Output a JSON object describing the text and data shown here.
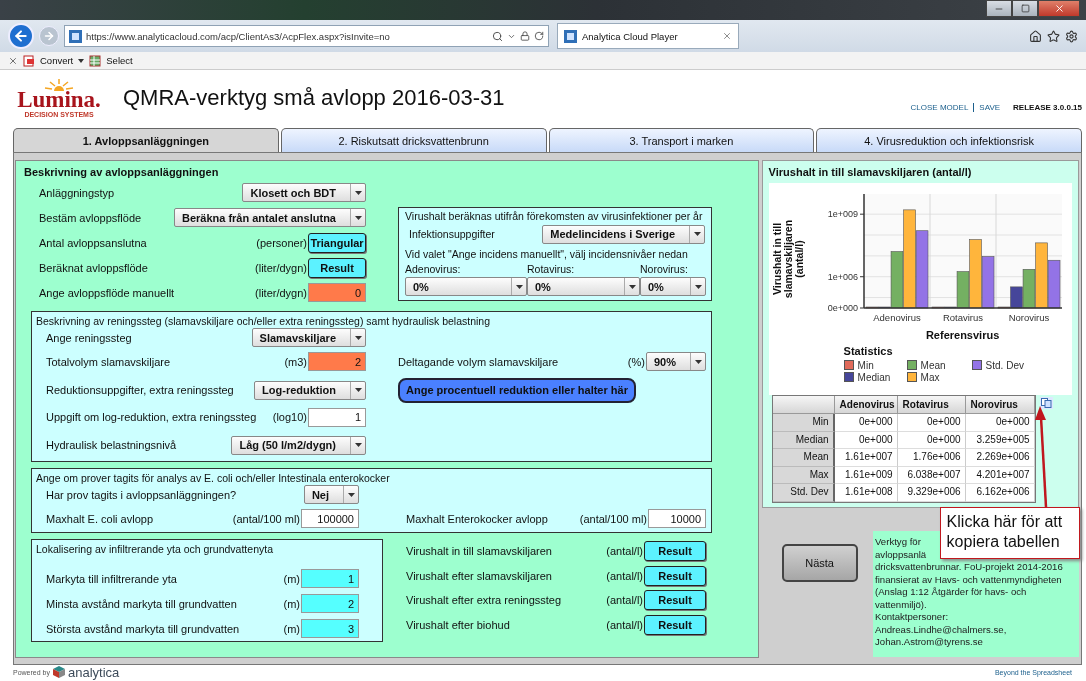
{
  "browser": {
    "url": "https://www.analyticacloud.com/acp/ClientAs3/AcpFlex.aspx?isInvite=no",
    "tab_title": "Analytica Cloud Player",
    "commands": [
      "Convert",
      "Select"
    ]
  },
  "header": {
    "logo": "Lumina.",
    "logo_sub": "DECISION SYSTEMS",
    "title": "QMRA-verktyg små avlopp 2016-03-31",
    "links": [
      "CLOSE MODEL",
      "SAVE"
    ],
    "release": "RELEASE 3.0.0.15"
  },
  "tabs": [
    {
      "label": "1. Avloppsanläggningen",
      "selected": true
    },
    {
      "label": "2. Riskutsatt dricksvattenbrunn",
      "selected": false
    },
    {
      "label": "3. Transport i marken",
      "selected": false
    },
    {
      "label": "4. Virusreduktion och infektionsrisk",
      "selected": false
    }
  ],
  "facility": {
    "title": "Beskrivning av avloppsanläggningen",
    "rows": [
      {
        "kind": "dropdown",
        "label": "Anläggningstyp",
        "value": "Klosett och BDT"
      },
      {
        "kind": "dropdown",
        "label": "Bestäm avloppsflöde",
        "value": "Beräkna från antalet anslutna"
      },
      {
        "kind": "button",
        "label": "Antal avloppsanslutna",
        "unit": "(personer)",
        "value": "Triangular"
      },
      {
        "kind": "button",
        "label": "Beräknat avloppsflöde",
        "unit": "(liter/dygn)",
        "value": "Result"
      },
      {
        "kind": "edit",
        "label": "Ange avloppsflöde manuellt",
        "unit": "(liter/dygn)",
        "value": "0"
      }
    ],
    "incidence": {
      "title": "Virushalt beräknas utifrån förekomsten av virusinfektioner per år",
      "field": {
        "kind": "dropdown",
        "label": "Infektionsuppgifter",
        "value": "Medelincidens i Sverige"
      },
      "hint": "Vid valet \"Ange incidens manuellt\", välj incidensnivåer nedan",
      "levels": [
        {
          "label": "Adenovirus:",
          "value": "0%"
        },
        {
          "label": "Rotavirus:",
          "value": "0%"
        },
        {
          "label": "Norovirus:",
          "value": "0%"
        }
      ]
    }
  },
  "treatment": {
    "title": "Beskrivning av reningssteg (slamavskiljare och/eller extra reningssteg) samt hydraulisk belastning",
    "left": [
      {
        "kind": "dropdown",
        "label": "Ange reningssteg",
        "value": "Slamavskiljare"
      },
      {
        "kind": "edit",
        "label": "Totalvolym slamavskiljare",
        "unit": "(m3)",
        "value": "2"
      },
      {
        "kind": "dropdown",
        "label": "Reduktionsuppgifter, extra reningssteg",
        "value": "Log-reduktion"
      },
      {
        "kind": "plain",
        "label": "Uppgift om log-reduktion, extra reningssteg",
        "unit": "(log10)",
        "value": "1"
      },
      {
        "kind": "dropdown",
        "label": "Hydraulisk belastningsnivå",
        "value": "Låg (50 l/m2/dygn)"
      }
    ],
    "right": [
      {
        "kind": "dropdown",
        "label": "Deltagande volym slamavskiljare",
        "unit": "(%)",
        "value": "90%"
      },
      {
        "kind": "action",
        "value": "Ange procentuell reduktion eller halter här"
      }
    ]
  },
  "samples": {
    "title": "Ange om prover tagits för analys av E. coli och/eller Intestinala enterokocker",
    "left": [
      {
        "kind": "dropdown",
        "label": "Har prov tagits i avloppsanläggningen?",
        "value": "Nej"
      },
      {
        "kind": "plain",
        "label": "Maxhalt E. coli avlopp",
        "unit": "(antal/100 ml)",
        "value": "100000"
      }
    ],
    "right": [
      {
        "kind": "plain",
        "label": "Maxhalt Enterokocker avlopp",
        "unit": "(antal/100 ml)",
        "value": "10000"
      }
    ]
  },
  "location": {
    "title": "Lokalisering av infiltrerande yta och grundvattenyta",
    "rows": [
      {
        "kind": "calc",
        "label": "Markyta till infiltrerande yta",
        "unit": "(m)",
        "value": "1"
      },
      {
        "kind": "calc",
        "label": "Minsta avstånd markyta till grundvatten",
        "unit": "(m)",
        "value": "2"
      },
      {
        "kind": "calc",
        "label": "Största avstånd markyta till grundvatten",
        "unit": "(m)",
        "value": "3"
      }
    ]
  },
  "results": [
    {
      "kind": "button",
      "label": "Virushalt in till slamavskiljaren",
      "unit": "(antal/l)",
      "value": "Result"
    },
    {
      "kind": "button",
      "label": "Virushalt efter slamavskiljaren",
      "unit": "(antal/l)",
      "value": "Result"
    },
    {
      "kind": "button",
      "label": "Virushalt efter extra reningssteg",
      "unit": "(antal/l)",
      "value": "Result"
    },
    {
      "kind": "button",
      "label": "Virushalt efter biohud",
      "unit": "(antal/l)",
      "value": "Result"
    }
  ],
  "chart_panel": {
    "title": "Virushalt in till slamavskiljaren (antal/l)",
    "ylabel": "Virushalt in till slamavskiljaren (antal/l)",
    "yticks": [
      "1e+009",
      "1e+006",
      "0e+000"
    ],
    "categories": [
      "Adenovirus",
      "Rotavirus",
      "Norovirus"
    ],
    "xlabel": "Referensvirus",
    "legend": {
      "title": "Statistics",
      "items": [
        {
          "name": "Min",
          "color": "#e06a5a"
        },
        {
          "name": "Median",
          "color": "#46469a"
        },
        {
          "name": "Mean",
          "color": "#74b062"
        },
        {
          "name": "Max",
          "color": "#ffb53c"
        },
        {
          "name": "Std. Dev",
          "color": "#9373e6"
        }
      ]
    },
    "table": {
      "columns": [
        "Adenovirus",
        "Rotavirus",
        "Norovirus"
      ],
      "rows": [
        {
          "label": "Min",
          "cells": [
            "0e+000",
            "0e+000",
            "0e+000"
          ]
        },
        {
          "label": "Median",
          "cells": [
            "0e+000",
            "0e+000",
            "3.259e+005"
          ]
        },
        {
          "label": "Mean",
          "cells": [
            "1.61e+007",
            "1.76e+006",
            "2.269e+006"
          ]
        },
        {
          "label": "Max",
          "cells": [
            "1.61e+009",
            "6.038e+007",
            "4.201e+007"
          ]
        },
        {
          "label": "Std. Dev",
          "cells": [
            "1.61e+008",
            "9.329e+006",
            "6.162e+006"
          ]
        }
      ]
    }
  },
  "callout": "Klicka här för att kopiera tabellen",
  "next_button": "Nästa",
  "info": [
    "Verktyg för",
    "avloppsanlä",
    "dricksvattenbrunnar. FoU-projekt 2014-2016",
    "finansierat av Havs- och vattenmyndigheten",
    "(Anslag 1:12 Åtgärder för havs- och",
    "vattenmiljö).",
    "Kontaktpersoner:",
    "Andreas.Lindhe@chalmers.se,",
    "Johan.Astrom@tyrens.se"
  ],
  "footer": {
    "powered": "Powered by",
    "brand": "analytica",
    "tagline": "Beyond the Spreadsheet"
  }
}
